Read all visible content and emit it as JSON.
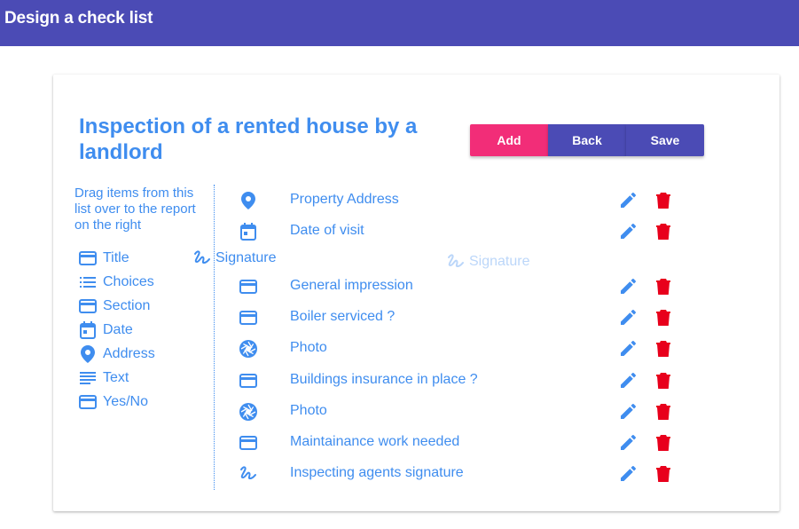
{
  "appbar": {
    "title": "Design a check list"
  },
  "report": {
    "title": "Inspection of a rented house by a landlord"
  },
  "actions": {
    "add_label": "Add",
    "back_label": "Back",
    "save_label": "Save"
  },
  "palette": {
    "instructions": "Drag items from this list over to the report on the right",
    "items": [
      {
        "label": "Title",
        "icon": "card-icon"
      },
      {
        "label": "Choices",
        "icon": "list-icon"
      },
      {
        "label": "Section",
        "icon": "card-icon"
      },
      {
        "label": "Date",
        "icon": "calendar-icon"
      },
      {
        "label": "Address",
        "icon": "location-pin-icon"
      },
      {
        "label": "Text",
        "icon": "text-lines-icon"
      },
      {
        "label": "Yes/No",
        "icon": "card-icon"
      }
    ]
  },
  "drag": {
    "item_label": "Signature",
    "ghost_label": "Signature",
    "icon": "signature-icon"
  },
  "checklist": {
    "items": [
      {
        "label": "Property Address",
        "icon": "location-pin-icon"
      },
      {
        "label": "Date of visit",
        "icon": "calendar-icon"
      },
      {
        "label": "General impression",
        "icon": "card-icon"
      },
      {
        "label": "Boiler serviced ?",
        "icon": "card-icon"
      },
      {
        "label": "Photo",
        "icon": "camera-aperture-icon"
      },
      {
        "label": "Buildings insurance in place ?",
        "icon": "card-icon"
      },
      {
        "label": "Photo",
        "icon": "camera-aperture-icon"
      },
      {
        "label": "Maintainance work needed",
        "icon": "card-icon"
      },
      {
        "label": "Inspecting agents signature",
        "icon": "signature-icon"
      }
    ]
  },
  "colors": {
    "appbar": "#4b4bb5",
    "accent_blue": "#3f8def",
    "add_button": "#f22d78",
    "delete_red": "#e8001c"
  }
}
